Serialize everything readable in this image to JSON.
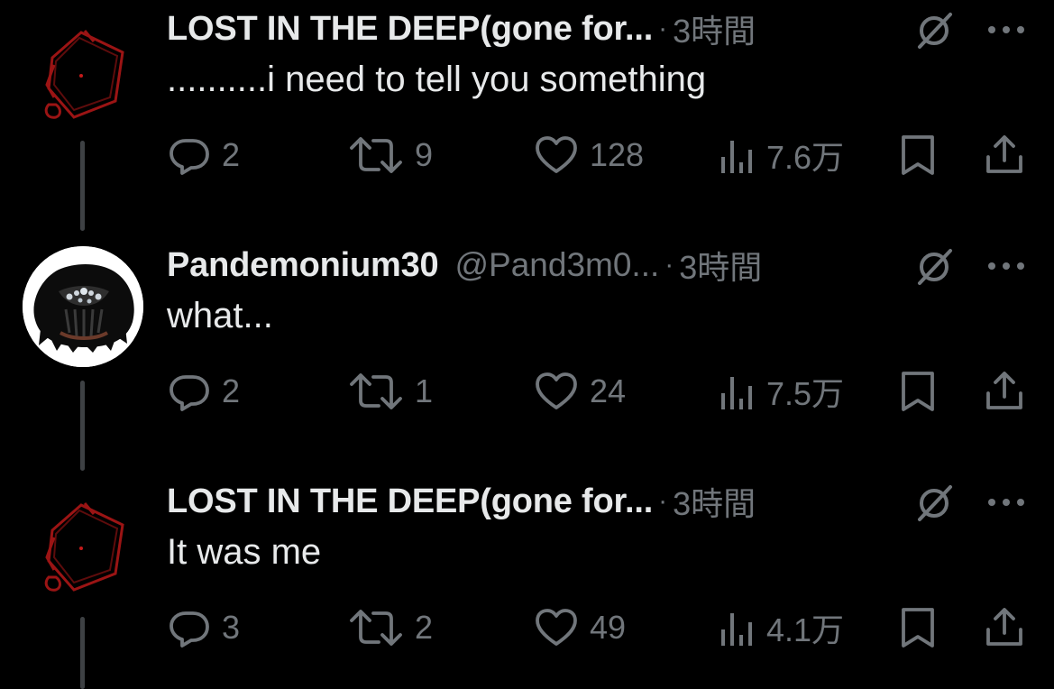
{
  "tweets": [
    {
      "name": "LOST IN THE DEEP(gone for...",
      "handle": "",
      "separator": "·",
      "time": "3時間",
      "text": "..........i need to tell you something",
      "replies": "2",
      "retweets": "9",
      "likes": "128",
      "views": "7.6万",
      "avatar": "red-pentagon-sketch-avatar"
    },
    {
      "name": "Pandemonium30",
      "handle": "@Pand3m0...",
      "separator": "·",
      "time": "3時間",
      "text": "what...",
      "replies": "2",
      "retweets": "1",
      "likes": "24",
      "views": "7.5万",
      "avatar": "dark-creature-avatar"
    },
    {
      "name": "LOST IN THE DEEP(gone for...",
      "handle": "",
      "separator": "·",
      "time": "3時間",
      "text": "It was me",
      "replies": "3",
      "retweets": "2",
      "likes": "49",
      "views": "4.1万",
      "avatar": "red-pentagon-sketch-avatar"
    }
  ],
  "icons": {
    "reply": "reply-icon",
    "retweet": "retweet-icon",
    "like": "heart-icon",
    "views": "views-icon",
    "bookmark": "bookmark-icon",
    "share": "share-icon",
    "mute": "mute-icon",
    "more": "more-icon"
  },
  "colors": {
    "background": "#000000",
    "text": "#e7e9ea",
    "muted": "#71767b",
    "thread_line": "#3e4144",
    "avatar_red": "#9b1414"
  }
}
